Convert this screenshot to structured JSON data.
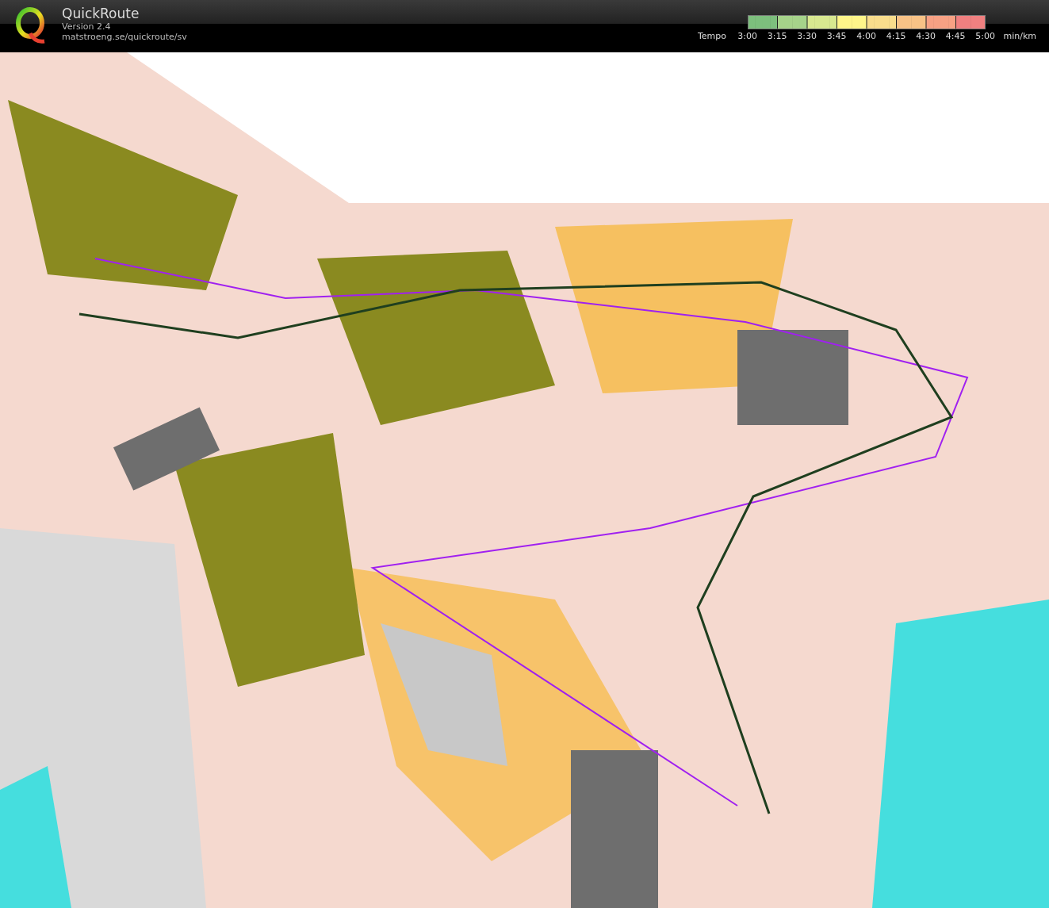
{
  "header": {
    "app_name": "QuickRoute",
    "version": "Version 2.4",
    "url": "matstroeng.se/quickroute/sv"
  },
  "legend": {
    "label": "Tempo",
    "ticks": [
      "3:00",
      "3:15",
      "3:30",
      "3:45",
      "4:00",
      "4:15",
      "4:30",
      "4:45",
      "5:00"
    ],
    "unit": "min/km"
  }
}
